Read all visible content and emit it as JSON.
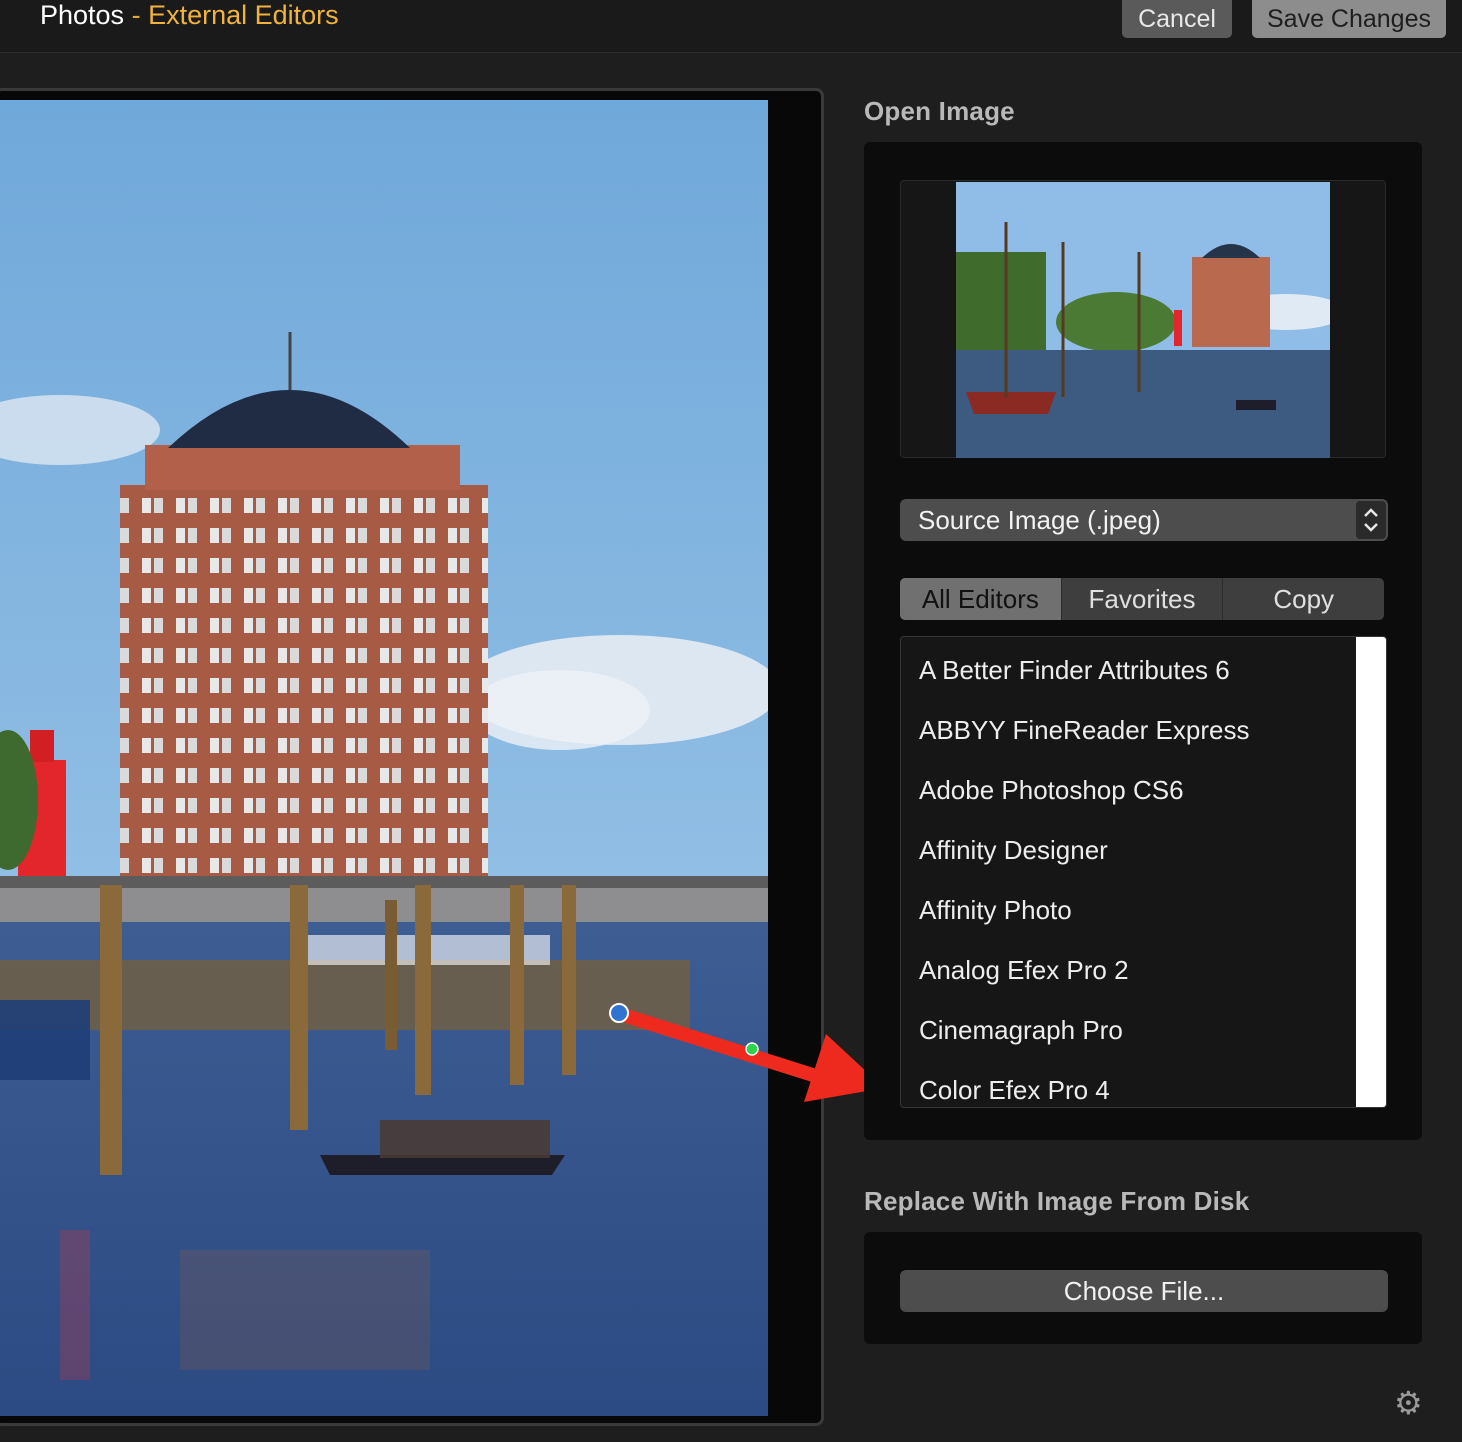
{
  "header": {
    "app_name": "Photos",
    "separator": "-",
    "section": "External Editors",
    "cancel_label": "Cancel",
    "save_label": "Save Changes"
  },
  "panel": {
    "open_image_heading": "Open Image",
    "source_select_value": "Source Image (.jpeg)",
    "tabs": [
      {
        "label": "All Editors",
        "active": true
      },
      {
        "label": "Favorites",
        "active": false
      },
      {
        "label": "Copy",
        "active": false
      }
    ],
    "editors": [
      "A Better Finder Attributes 6",
      "ABBYY FineReader Express",
      "Adobe Photoshop CS6",
      "Affinity Designer",
      "Affinity Photo",
      "Analog Efex Pro 2",
      "Cinemagraph Pro",
      "Color Efex Pro 4"
    ],
    "replace_heading": "Replace With Image From Disk",
    "choose_file_label": "Choose File..."
  },
  "colors": {
    "accent": "#f0b43c",
    "annotation_arrow": "#ee2a1e",
    "annotation_handle": "#2f74d0"
  }
}
